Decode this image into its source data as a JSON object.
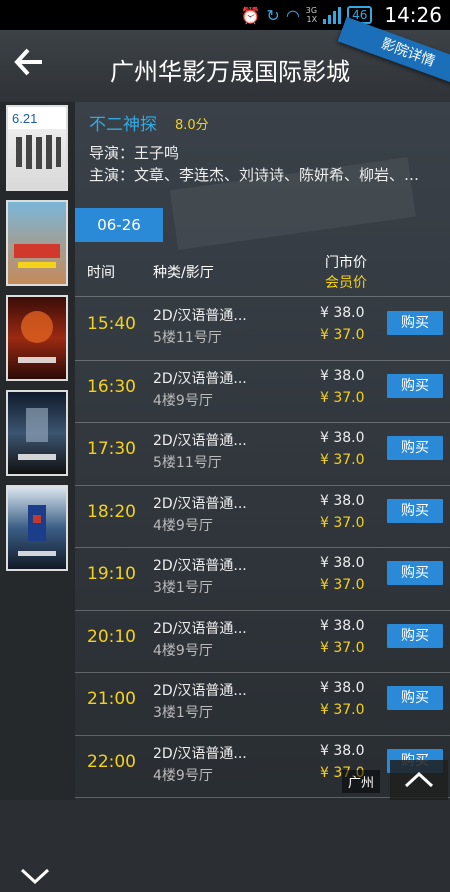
{
  "status": {
    "time": "14:26",
    "network_top": "3G",
    "network_bottom": "1X",
    "battery_badge": "46"
  },
  "header": {
    "title": "广州华影万晟国际影城",
    "ribbon": "影院详情"
  },
  "movie": {
    "title": "不二神探",
    "rating": "8.0分",
    "director": "导演：王子鸣",
    "cast": "主演：文章、李连杰、刘诗诗、陈妍希、柳岩、…"
  },
  "date_tab": "06-26",
  "columns": {
    "time": "时间",
    "type": "种类/影厅",
    "price": "门市价",
    "member_price": "会员价"
  },
  "showtimes": [
    {
      "time": "15:40",
      "type": "2D/汉语普通...",
      "hall": "5楼11号厅",
      "price": "¥ 38.0",
      "member": "¥ 37.0",
      "buy": "购买"
    },
    {
      "time": "16:30",
      "type": "2D/汉语普通...",
      "hall": "4楼9号厅",
      "price": "¥ 38.0",
      "member": "¥ 37.0",
      "buy": "购买"
    },
    {
      "time": "17:30",
      "type": "2D/汉语普通...",
      "hall": "5楼11号厅",
      "price": "¥ 38.0",
      "member": "¥ 37.0",
      "buy": "购买"
    },
    {
      "time": "18:20",
      "type": "2D/汉语普通...",
      "hall": "4楼9号厅",
      "price": "¥ 38.0",
      "member": "¥ 37.0",
      "buy": "购买"
    },
    {
      "time": "19:10",
      "type": "2D/汉语普通...",
      "hall": "3楼1号厅",
      "price": "¥ 38.0",
      "member": "¥ 37.0",
      "buy": "购买"
    },
    {
      "time": "20:10",
      "type": "2D/汉语普通...",
      "hall": "4楼9号厅",
      "price": "¥ 38.0",
      "member": "¥ 37.0",
      "buy": "购买"
    },
    {
      "time": "21:00",
      "type": "2D/汉语普通...",
      "hall": "3楼1号厅",
      "price": "¥ 38.0",
      "member": "¥ 37.0",
      "buy": "购买"
    },
    {
      "time": "22:00",
      "type": "2D/汉语普通...",
      "hall": "4楼9号厅",
      "price": "¥ 38.0",
      "member": "¥ 37.0",
      "buy": "购买"
    }
  ],
  "footer": {
    "city": "广州"
  },
  "colors": {
    "accent_blue": "#2a8ad8",
    "member_yellow": "#f3d21a"
  }
}
